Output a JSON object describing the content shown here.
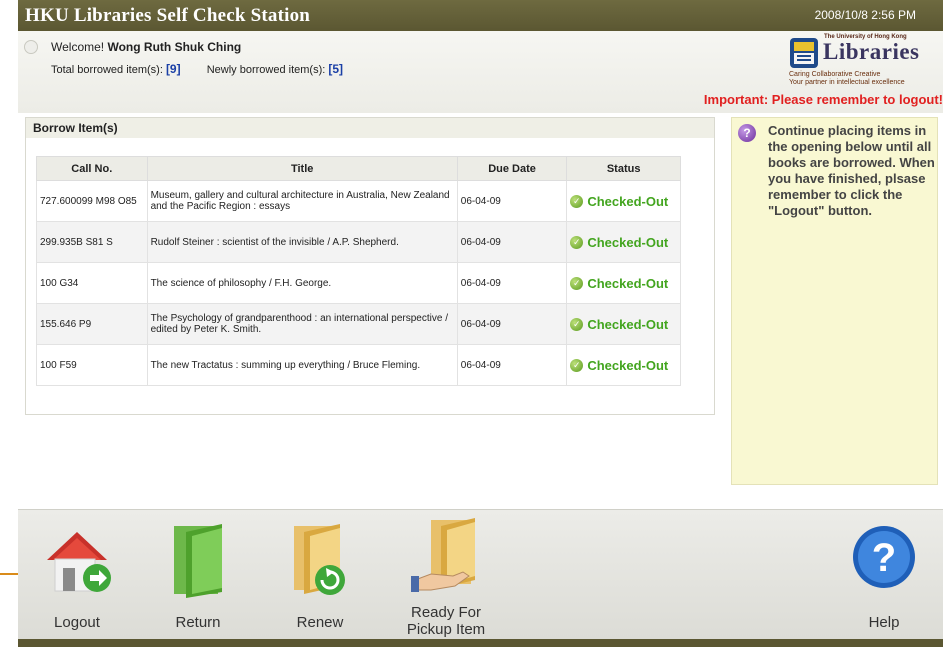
{
  "app": {
    "title": "HKU Libraries Self Check Station",
    "datetime": "2008/10/8 2:56 PM"
  },
  "header": {
    "welcome_prefix": "Welcome!",
    "user_name": "Wong Ruth Shuk Ching",
    "total_label": "Total borrowed item(s):",
    "total_value": "[9]",
    "new_label": "Newly borrowed item(s):",
    "new_value": "[5]",
    "important": "Important: Please remember to logout!"
  },
  "logo": {
    "university": "The University of Hong Kong",
    "name": "Libraries",
    "tagline1": "Caring Collaborative Creative",
    "tagline2": "Your partner in intellectual excellence"
  },
  "borrow": {
    "heading": "Borrow Item(s)",
    "columns": [
      "Call No.",
      "Title",
      "Due Date",
      "Status"
    ],
    "rows": [
      {
        "call_no": "727.600099 M98 O85",
        "title": "Museum, gallery and cultural architecture in Australia, New Zealand and the Pacific Region : essays",
        "due": "06-04-09",
        "status": "Checked-Out"
      },
      {
        "call_no": "299.935B S81 S",
        "title": "Rudolf Steiner : scientist of the invisible / A.P. Shepherd.",
        "due": "06-04-09",
        "status": "Checked-Out"
      },
      {
        "call_no": "100 G34",
        "title": "The science of philosophy / F.H. George.",
        "due": "06-04-09",
        "status": "Checked-Out"
      },
      {
        "call_no": "155.646 P9",
        "title": "The Psychology of grandparenthood : an international perspective / edited by Peter K. Smith.",
        "due": "06-04-09",
        "status": "Checked-Out"
      },
      {
        "call_no": "100 F59",
        "title": "The new Tractatus : summing up everything / Bruce Fleming.",
        "due": "06-04-09",
        "status": "Checked-Out"
      }
    ]
  },
  "info": {
    "message": "Continue placing items in the opening below until all books are borrowed. When you have finished, plsase remember to click the \"Logout\" button."
  },
  "toolbar": {
    "logout": "Logout",
    "return": "Return",
    "renew": "Renew",
    "pickup_line1": "Ready For",
    "pickup_line2": "Pickup Item",
    "help": "Help"
  },
  "colors": {
    "titlebar": "#5b5732",
    "important": "#e12020",
    "status_ok": "#43a51f",
    "count_number": "#1a3fa6",
    "info_bg": "#f9f8d2"
  }
}
